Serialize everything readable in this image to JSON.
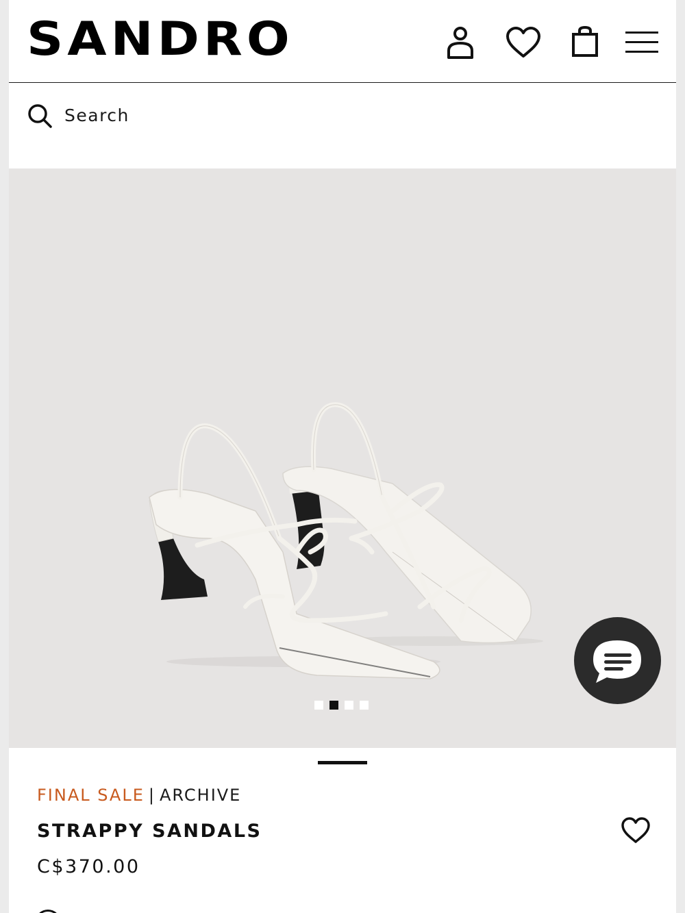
{
  "brand": {
    "logo_text": "SANDRO"
  },
  "header": {
    "icons": [
      "account-icon",
      "wishlist-heart-icon",
      "shopping-bag-icon",
      "hamburger-menu-icon"
    ]
  },
  "search": {
    "label": "Search",
    "icon": "search-icon"
  },
  "gallery": {
    "image_description_icon": "product-photo",
    "slides": 4,
    "active_slide": 2,
    "background_color": "#e6e4e3"
  },
  "chat": {
    "icon": "chat-bubble-icon",
    "color": "#2b2b2b"
  },
  "product": {
    "tag_sale": "FINAL SALE",
    "tag_separator": "|",
    "tag_collection": "ARCHIVE",
    "name": "STRAPPY SANDALS",
    "price": "C$370.00",
    "sale_color": "#c85a1e"
  }
}
